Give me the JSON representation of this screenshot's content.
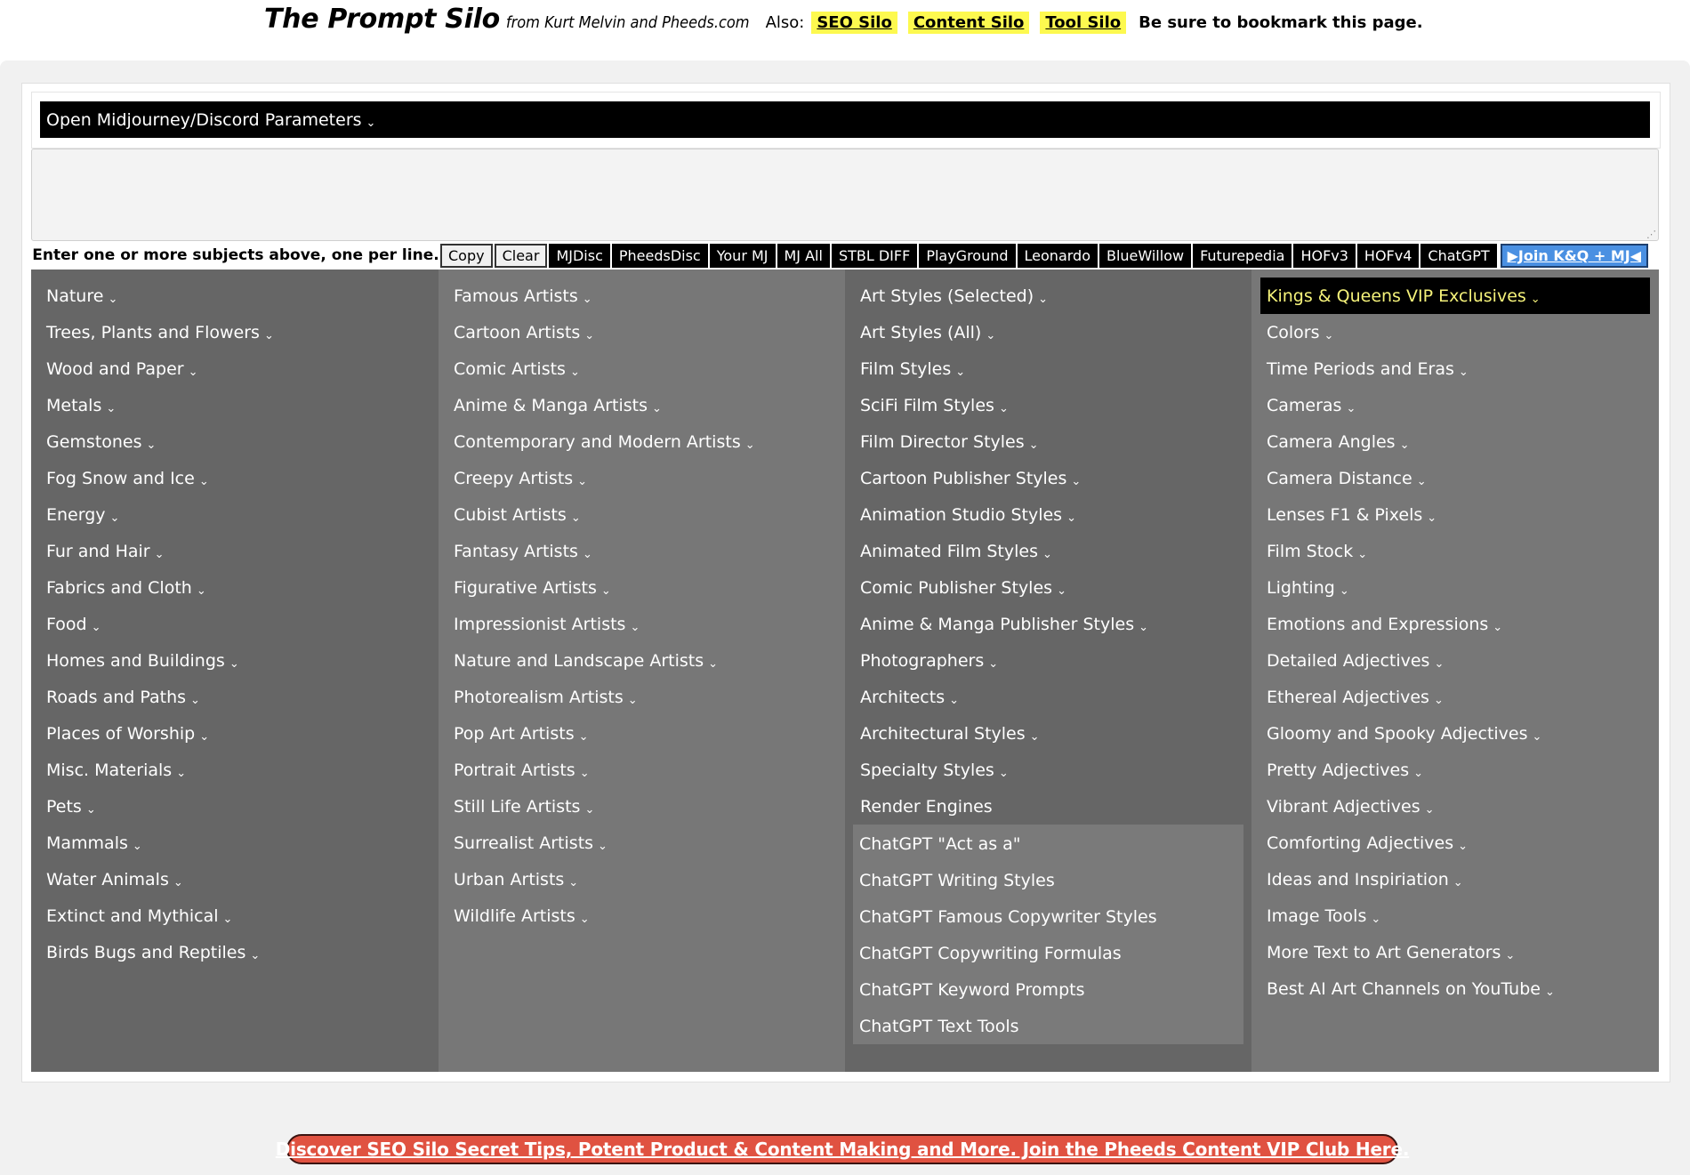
{
  "header": {
    "title": "The Prompt Silo",
    "subtitle": "from Kurt Melvin and Pheeds.com",
    "also_label": "Also:",
    "silo_links": [
      "SEO Silo",
      "Content Silo",
      "Tool Silo"
    ],
    "bookmark_note": "Be sure to bookmark this page.",
    "highlight_color": "#fdf94f"
  },
  "params_bar": {
    "label": "Open Midjourney/Discord Parameters",
    "chevron": "⌄"
  },
  "subjects_input": {
    "value": "",
    "placeholder": ""
  },
  "toolbar": {
    "hint": "Enter one or more subjects above, one per line.",
    "copy_label": "Copy",
    "clear_label": "Clear",
    "links": [
      "MJDisc",
      "PheedsDisc",
      "Your MJ",
      "MJ All",
      "STBL DIFF",
      "PlayGround",
      "Leonardo",
      "BlueWillow",
      "Futurepedia",
      "HOFv3",
      "HOFv4",
      "ChatGPT"
    ],
    "join_label": "▶Join K&Q + MJ◀",
    "join_color": "#4a90e2"
  },
  "menu": {
    "chevron": "⌄",
    "col1": [
      "Nature",
      "Trees, Plants and Flowers",
      "Wood and Paper",
      "Metals",
      "Gemstones",
      "Fog Snow and Ice",
      "Energy",
      "Fur and Hair",
      "Fabrics and Cloth",
      "Food",
      "Homes and Buildings",
      "Roads and Paths",
      "Places of Worship",
      "Misc. Materials",
      "Pets",
      "Mammals",
      "Water Animals",
      "Extinct and Mythical",
      "Birds Bugs and Reptiles"
    ],
    "col2": [
      "Famous Artists",
      "Cartoon Artists",
      "Comic Artists",
      "Anime & Manga Artists",
      "Contemporary and Modern Artists",
      "Creepy Artists",
      "Cubist Artists",
      "Fantasy Artists",
      "Figurative Artists",
      "Impressionist Artists",
      "Nature and Landscape Artists",
      "Photorealism Artists",
      "Pop Art Artists",
      "Portrait Artists",
      "Still Life Artists",
      "Surrealist Artists",
      "Urban Artists",
      "Wildlife Artists"
    ],
    "col3": [
      "Art Styles (Selected)",
      "Art Styles (All)",
      "Film Styles",
      "SciFi Film Styles",
      "Film Director Styles",
      "Cartoon Publisher Styles",
      "Animation Studio Styles",
      "Animated Film Styles",
      "Comic Publisher Styles",
      "Anime & Manga Publisher Styles",
      "Photographers",
      "Architects",
      "Architectural Styles",
      "Specialty Styles"
    ],
    "col3_plain": [
      "Render Engines"
    ],
    "col3_chatgpt": [
      "ChatGPT \"Act as a\"",
      "ChatGPT Writing Styles",
      "ChatGPT Famous Copywriter Styles",
      "ChatGPT Copywriting Formulas",
      "ChatGPT Keyword Prompts",
      "ChatGPT Text Tools"
    ],
    "col4_vip": "Kings & Queens VIP Exclusives",
    "col4": [
      "Colors",
      "Time Periods and Eras",
      "Cameras",
      "Camera Angles",
      "Camera Distance",
      "Lenses F1 & Pixels",
      "Film Stock",
      "Lighting",
      "Emotions and Expressions",
      "Detailed Adjectives",
      "Ethereal Adjectives",
      "Gloomy and Spooky Adjectives",
      "Pretty Adjectives",
      "Vibrant Adjectives",
      "Comforting Adjectives",
      "Ideas and Inspiriation",
      "Image Tools",
      "More Text to Art Generators",
      "Best AI Art Channels on YouTube"
    ],
    "vip_text_color": "#f5f27a"
  },
  "promo": {
    "label": "Discover SEO Silo Secret Tips, Potent Product & Content Making and More. Join the Pheeds Content VIP Club Here.",
    "color": "#e05241"
  }
}
